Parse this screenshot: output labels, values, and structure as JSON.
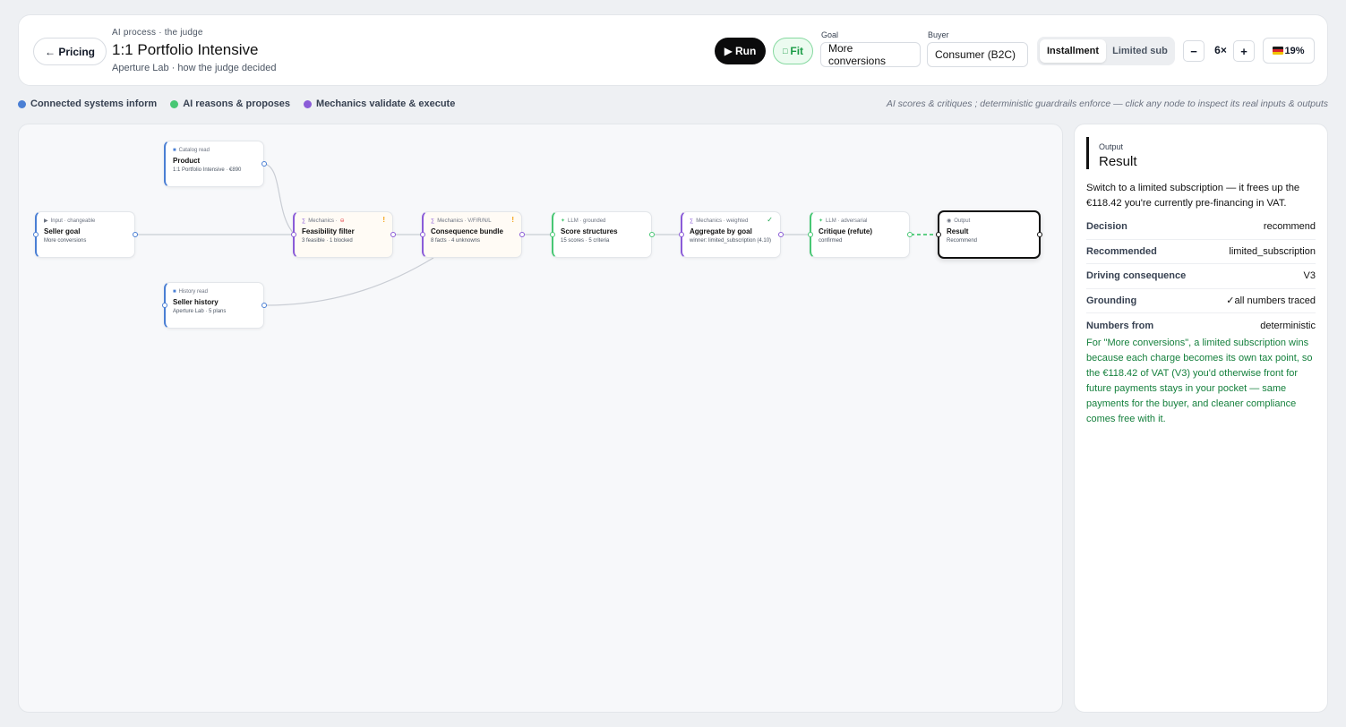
{
  "header": {
    "back_label": "← Pricing",
    "kicker": "AI process · the judge",
    "title": "1:1 Portfolio Intensive",
    "subtitle": "Aperture Lab · how the judge decided",
    "run_label": "Run",
    "fit_label": "Fit",
    "goal_label": "Goal",
    "goal_value": "More conversions",
    "buyer_label": "Buyer",
    "buyer_value": "Consumer (B2C)",
    "toggle_options": [
      "Installment",
      "Limited sub"
    ],
    "toggle_selected": "Installment",
    "minus_label": "−",
    "multiplier": "6×",
    "plus_label": "+",
    "vat_label": "19%"
  },
  "legend": {
    "items": [
      {
        "label": "Connected systems inform",
        "color": "#4a7fd4"
      },
      {
        "label": "AI reasons & proposes",
        "color": "#48c774"
      },
      {
        "label": "Mechanics validate & execute",
        "color": "#8b5cd8"
      }
    ],
    "hint": "AI  scores & critiques  ; deterministic guardrails  enforce  — click any node to inspect its real inputs & outputs"
  },
  "nodes": {
    "catalog": {
      "kicker": "Catalog read",
      "title": "Product",
      "sub": "1:1 Portfolio Intensive · €890"
    },
    "input": {
      "kicker": "Input · changeable",
      "title": "Seller goal",
      "sub": "More conversions"
    },
    "history": {
      "kicker": "History read",
      "title": "Seller history",
      "sub": "Aperture Lab · 5 plans"
    },
    "feasibility": {
      "kicker": "Mechanics ·",
      "title": "Feasibility filter",
      "sub": "3 feasible · 1 blocked",
      "flag": "!"
    },
    "consequence": {
      "kicker": "Mechanics · V/F/R/N/L",
      "title": "Consequence bundle",
      "sub": "8 facts · 4 unknowns",
      "flag": "!"
    },
    "score": {
      "kicker": "LLM · grounded",
      "title": "Score structures",
      "sub": "15 scores · 5 criteria"
    },
    "aggregate": {
      "kicker": "Mechanics · weighted",
      "title": "Aggregate by goal",
      "sub": "winner: limited_subscription (4.10)",
      "flag": "✓"
    },
    "critique": {
      "kicker": "LLM · adversarial",
      "title": "Critique (refute)",
      "sub": "confirmed"
    },
    "output": {
      "kicker": "Output",
      "title": "Result",
      "sub": "Recommend"
    }
  },
  "panel": {
    "kicker": "Output",
    "title": "Result",
    "summary": "Switch to a limited subscription — it frees up the €118.42 you're currently pre-financing in VAT.",
    "rows": [
      {
        "key": "Decision",
        "value": "recommend"
      },
      {
        "key": "Recommended",
        "value": "limited_subscription"
      },
      {
        "key": "Driving consequence",
        "value": "V3"
      },
      {
        "key": "Grounding",
        "value": "✓all numbers traced"
      },
      {
        "key": "Numbers from",
        "value": "deterministic"
      }
    ],
    "explanation": "For \"More conversions\", a limited subscription wins because each charge becomes its own tax point, so the €118.42 of VAT (V3) you'd otherwise front for future payments stays in your pocket — same payments for the buyer, and cleaner compliance comes free with it."
  }
}
